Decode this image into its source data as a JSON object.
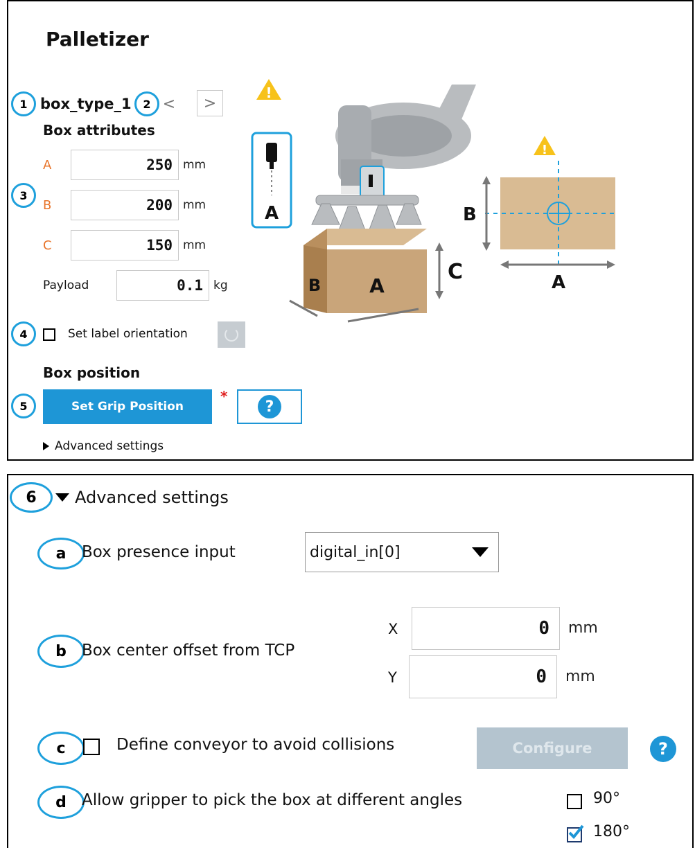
{
  "top_panel": {
    "title": "Palletizer",
    "box_type": "box_type_1",
    "nav": {
      "prev": "<",
      "next": ">"
    },
    "box_attributes_heading": "Box attributes",
    "dims": [
      {
        "label": "A",
        "value": "250",
        "unit": "mm"
      },
      {
        "label": "B",
        "value": "200",
        "unit": "mm"
      },
      {
        "label": "C",
        "value": "150",
        "unit": "mm"
      }
    ],
    "payload": {
      "label": "Payload",
      "value": "0.1",
      "unit": "kg"
    },
    "label_orientation": {
      "label": "Set label orientation",
      "checked": false
    },
    "box_position_heading": "Box position",
    "set_grip_button": "Set Grip Position",
    "required_marker": "*",
    "help_glyph": "?",
    "advanced_toggle": "Advanced settings",
    "callouts": [
      "1",
      "2",
      "3",
      "4",
      "5"
    ],
    "illustration": {
      "warning_glyph": "!",
      "tool_label": "A",
      "box_face_left": "B",
      "box_face_front": "A",
      "height_label": "C",
      "top_view_side_label": "B",
      "top_view_bottom_label": "A"
    }
  },
  "bottom_panel": {
    "callout_main": "6",
    "advanced_heading": "Advanced settings",
    "presence": {
      "callout": "a",
      "label": "Box presence input",
      "selected": "digital_in[0]"
    },
    "offset": {
      "callout": "b",
      "label": "Box center offset from TCP",
      "x_label": "X",
      "x_value": "0",
      "x_unit": "mm",
      "y_label": "Y",
      "y_value": "0",
      "y_unit": "mm"
    },
    "conveyor": {
      "callout": "c",
      "label": "Define conveyor to avoid collisions",
      "checked": false,
      "configure_button": "Configure",
      "help_glyph": "?"
    },
    "angles": {
      "callout": "d",
      "label": "Allow gripper to pick the box at different angles",
      "options": [
        {
          "label": "90°",
          "checked": false
        },
        {
          "label": "180°",
          "checked": true
        }
      ]
    }
  },
  "colors": {
    "accent": "#1ea0dc",
    "orange_label": "#e8742a",
    "button_blue": "#1e96d6",
    "required_red": "#e02020",
    "disabled_button": "#b4c4cf",
    "box_tan": "#c9a57a",
    "warning_yellow": "#f7c21a"
  }
}
